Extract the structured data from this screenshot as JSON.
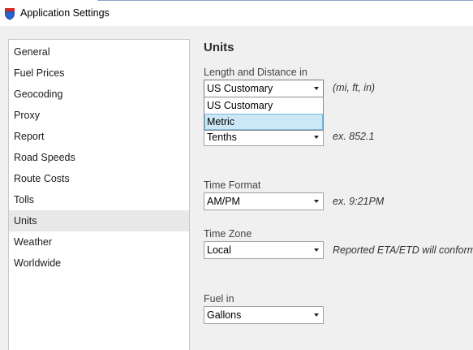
{
  "window": {
    "title": "Application Settings",
    "icon": "shield-icon"
  },
  "sidebar": {
    "items": [
      {
        "label": "General",
        "selected": false
      },
      {
        "label": "Fuel Prices",
        "selected": false
      },
      {
        "label": "Geocoding",
        "selected": false
      },
      {
        "label": "Proxy",
        "selected": false
      },
      {
        "label": "Report",
        "selected": false
      },
      {
        "label": "Road Speeds",
        "selected": false
      },
      {
        "label": "Route Costs",
        "selected": false
      },
      {
        "label": "Tolls",
        "selected": false
      },
      {
        "label": "Units",
        "selected": true
      },
      {
        "label": "Weather",
        "selected": false
      },
      {
        "label": "Worldwide",
        "selected": false
      }
    ]
  },
  "units": {
    "section_title": "Units",
    "length": {
      "label": "Length and Distance in",
      "value": "US Customary",
      "hint": "(mi, ft, in)",
      "options": [
        "US Customary",
        "Metric"
      ],
      "highlighted_option": "Metric"
    },
    "precision": {
      "value": "Tenths",
      "hint": "ex. 852.1"
    },
    "time_format": {
      "label": "Time Format",
      "value": "AM/PM",
      "hint": "ex. 9:21PM"
    },
    "time_zone": {
      "label": "Time Zone",
      "value": "Local",
      "hint": "Reported ETA/ETD will conform to"
    },
    "fuel": {
      "label": "Fuel in",
      "value": "Gallons"
    }
  },
  "colors": {
    "selection_highlight": "#cce8f6",
    "sidebar_selected": "#e8e8e8",
    "icon_blue": "#1f4fa8",
    "icon_red": "#d62a2a"
  }
}
